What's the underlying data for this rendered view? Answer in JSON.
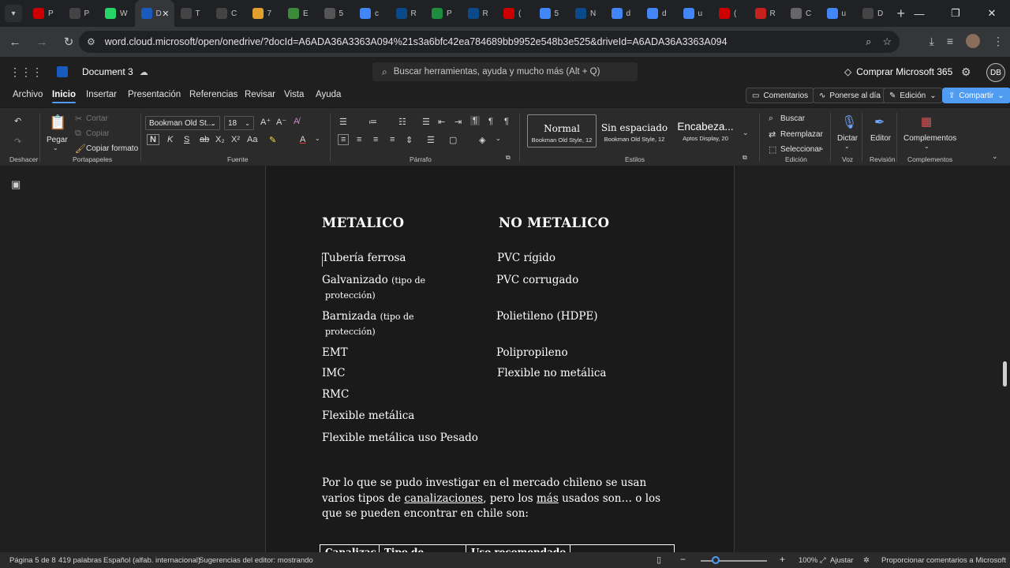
{
  "browser": {
    "tabs": [
      {
        "letter": "P",
        "color": "#c00"
      },
      {
        "letter": "P",
        "color": "#444"
      },
      {
        "letter": "W",
        "color": "#25d366"
      },
      {
        "letter": "D",
        "color": "#185abd",
        "active": true
      },
      {
        "letter": "T",
        "color": "#444"
      },
      {
        "letter": "C",
        "color": "#444"
      },
      {
        "letter": "7",
        "color": "#e0a030"
      },
      {
        "letter": "E",
        "color": "#3a8a3a"
      },
      {
        "letter": "5",
        "color": "#555"
      },
      {
        "letter": "c",
        "color": "#4285f4"
      },
      {
        "letter": "R",
        "color": "#0a4a8a"
      },
      {
        "letter": "P",
        "color": "#1e8e3e"
      },
      {
        "letter": "R",
        "color": "#0a4a8a"
      },
      {
        "letter": "(",
        "color": "#c00"
      },
      {
        "letter": "5",
        "color": "#4285f4"
      },
      {
        "letter": "N",
        "color": "#0a4a8a"
      },
      {
        "letter": "d",
        "color": "#4285f4"
      },
      {
        "letter": "d",
        "color": "#4285f4"
      },
      {
        "letter": "u",
        "color": "#4285f4"
      },
      {
        "letter": "(",
        "color": "#c00"
      },
      {
        "letter": "R",
        "color": "#c5221f"
      },
      {
        "letter": "C",
        "color": "#666"
      },
      {
        "letter": "u",
        "color": "#4285f4"
      },
      {
        "letter": "D",
        "color": "#444"
      }
    ],
    "url": "word.cloud.microsoft/open/onedrive/?docId=A6ADA36A3363A094%21s3a6bfc42ea784689bb9952e548b3e525&driveId=A6ADA36A3363A094"
  },
  "word": {
    "doc_title": "Document 3",
    "search_placeholder": "Buscar herramientas, ayuda y mucho más (Alt + Q)",
    "buy_label": "Comprar Microsoft 365",
    "profile_initials": "DB"
  },
  "ribbon_tabs": [
    "Archivo",
    "Inicio",
    "Insertar",
    "Presentación",
    "Referencias",
    "Revisar",
    "Vista",
    "Ayuda"
  ],
  "ribbon_buttons": {
    "comments": "Comentarios",
    "catchup": "Ponerse al día",
    "editing": "Edición",
    "share": "Compartir"
  },
  "ribbon": {
    "undo_label": "Deshacer",
    "paste": "Pegar",
    "cut": "Cortar",
    "copy": "Copiar",
    "format_painter": "Copiar formato",
    "clipboard_label": "Portapapeles",
    "font_name": "Bookman Old St...",
    "font_size": "18",
    "font_label": "Fuente",
    "paragraph_label": "Párrafo",
    "styles": [
      {
        "name": "Normal",
        "desc": "Bookman Old Style, 12"
      },
      {
        "name": "Sin espaciado",
        "desc": "Bookman Old Style, 12"
      },
      {
        "name": "Encabeza...",
        "desc": "Aptos Display, 20"
      }
    ],
    "styles_label": "Estilos",
    "find": "Buscar",
    "replace": "Reemplazar",
    "select": "Seleccionar",
    "editing_label": "Edición",
    "dictate": "Dictar",
    "voice_label": "Voz",
    "editor": "Editor",
    "review_label": "Revisión",
    "addins": "Complementos",
    "addins_label": "Complementos"
  },
  "document": {
    "heading_metal": "METALICO",
    "heading_nonmetal": "NO METALICO",
    "metal_items": [
      {
        "text": "Tubería ferrosa"
      },
      {
        "text": "Galvanizado",
        "note": "(tipo de",
        "note2": "protección)"
      },
      {
        "text": "Barnizada",
        "note": "(tipo de",
        "note2": "protección)"
      },
      {
        "text": "EMT"
      },
      {
        "text": "IMC"
      },
      {
        "text": "RMC"
      },
      {
        "text": "Flexible metálica"
      },
      {
        "text": "Flexible metálica uso Pesado"
      }
    ],
    "nonmetal_items": [
      "PVC rígido",
      "PVC corrugado",
      "Polietileno (HDPE)",
      "Polipropileno",
      "Flexible no metálica"
    ],
    "paragraph": {
      "p1": "Por lo que se pudo investigar en el mercado chileno se usan varios tipos de ",
      "u1": "canalizaciones",
      "p2": ", pero los ",
      "u2": "más",
      "p3": " usados son… o los que se pueden encontrar en chile son:"
    },
    "table_headers": [
      "Canalizac",
      "Tipo de",
      "Uso recomendado",
      ""
    ]
  },
  "status": {
    "page": "Página 5 de 8",
    "words": "419 palabras",
    "language": "Español (alfab. internacional)",
    "suggestions": "Sugerencias del editor: mostrando",
    "zoom": "100%",
    "fit": "Ajustar",
    "feedback": "Proporcionar comentarios a Microsoft"
  }
}
